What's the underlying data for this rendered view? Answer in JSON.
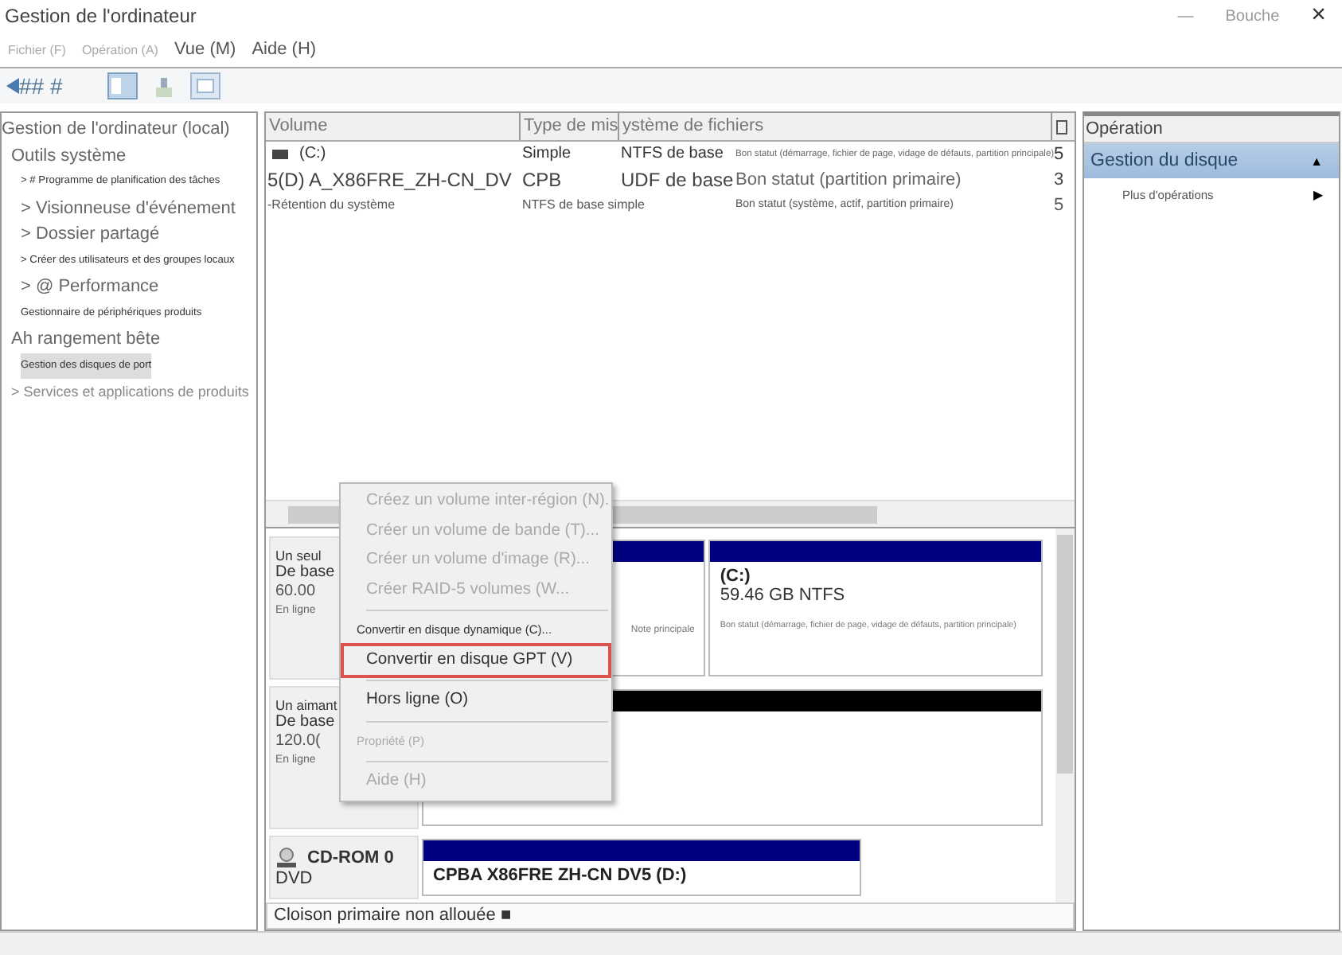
{
  "window": {
    "title": "Gestion de l'ordinateur",
    "controls": [
      "—",
      "Bouche",
      "×"
    ]
  },
  "menu": [
    "Fichier (F)",
    "Opération (A)",
    "Vue (M)",
    "Aide (H)"
  ],
  "toolbar": {
    "text": "## #"
  },
  "tree": [
    {
      "label": "Gestion de l'ordinateur (local)",
      "kind": "large",
      "selected": false,
      "children": [
        {
          "label": "Outils système",
          "kind": "large",
          "selected": false,
          "children": [
            {
              "label": "> # Programme de planification des tâches",
              "kind": "small",
              "selected": false
            },
            {
              "label": "> Visionneuse d'événement",
              "kind": "large",
              "selected": false
            },
            {
              "label": "> Dossier partagé",
              "kind": "large",
              "selected": false
            },
            {
              "label": "> Créer des utilisateurs et des groupes locaux",
              "kind": "small",
              "selected": false
            },
            {
              "label": "> @ Performance",
              "kind": "large",
              "selected": false
            },
            {
              "label": "Gestionnaire de périphériques produits",
              "kind": "small",
              "selected": false
            }
          ]
        },
        {
          "label": "Ah rangement bête",
          "kind": "large",
          "selected": false,
          "children": [
            {
              "label": "Gestion des disques de port",
              "kind": "small",
              "selected": true
            }
          ]
        },
        {
          "label": "> Services et applications de produits",
          "kind": "medium",
          "selected": false
        }
      ]
    }
  ],
  "table": {
    "columns": [
      "Volume",
      "Type de mis",
      "ystème de fichiers"
    ],
    "rows": [
      {
        "volume": "(C:)",
        "type": "Simple",
        "filesystem": "NTFS de base",
        "status": "Bon statut (démarrage, fichier de page, vidage de défauts, partition principale)",
        "capacity": "5"
      },
      {
        "volume": "5(D) A_X86FRE_ZH-CN_DV",
        "type": "CPB",
        "filesystem": "UDF de base",
        "status": "Bon statut (partition primaire)",
        "capacity": "3"
      },
      {
        "volume": "-Rétention du système",
        "type": "NTFS de base simple",
        "status": "Bon statut (système, actif, partition primaire)",
        "capacity": "5"
      }
    ]
  },
  "disks": [
    {
      "name": "Un seul",
      "kind": "basic",
      "lines": [
        "De base",
        "60.00",
        "En ligne"
      ],
      "partitions": [
        {
          "color": "#000080",
          "lines": [
            "Note principale"
          ]
        },
        {
          "color": "#000080",
          "title": "(C:)",
          "lines": [
            "59.46 GB NTFS",
            "Bon statut (démarrage, fichier de page, vidage de défauts, partition principale)"
          ]
        }
      ]
    },
    {
      "name": "Un aimant",
      "kind": "basic",
      "lines": [
        "De base",
        "120.0(",
        "En ligne"
      ],
      "partitions": [
        {
          "color": "#000000"
        }
      ]
    },
    {
      "name": "CD-ROM 0",
      "kind": "cdrom",
      "lines": [
        "DVD"
      ],
      "partitions": [
        {
          "color": "#000080",
          "title": "CPBA X86FRE ZH-CN DV5  (D:)"
        }
      ]
    }
  ],
  "legend": "Cloison primaire non allouée ■",
  "context_menu": [
    {
      "label": "Créez un volume inter-région (N).",
      "kind": "large",
      "disabled": true,
      "highlighted": false
    },
    {
      "label": "Créer un volume de bande (T)...",
      "kind": "large",
      "disabled": true,
      "highlighted": false
    },
    {
      "label": "Créer un volume d'image (R)...",
      "kind": "large",
      "disabled": true,
      "highlighted": false
    },
    {
      "label": "Créer RAID-5 volumes (W...",
      "kind": "large",
      "disabled": true,
      "highlighted": false
    },
    {
      "label": "Convertir en disque dynamique (C)...",
      "kind": "small",
      "disabled": false,
      "highlighted": false
    },
    {
      "label": "Convertir en disque GPT (V)",
      "kind": "large",
      "disabled": false,
      "highlighted": true
    },
    {
      "label": "Hors ligne (O)",
      "kind": "large",
      "disabled": false,
      "highlighted": false
    },
    {
      "label": "Propriété (P)",
      "kind": "small",
      "disabled": true,
      "highlighted": false
    },
    {
      "label": "Aide (H)",
      "kind": "large",
      "disabled": true,
      "highlighted": false
    }
  ],
  "operations": {
    "title": "Opération",
    "items": [
      {
        "label": "Gestion du disque",
        "selected": true,
        "arrow": "▲"
      },
      {
        "label": "Plus d'opérations",
        "selected": false,
        "arrow": "▶"
      }
    ]
  }
}
